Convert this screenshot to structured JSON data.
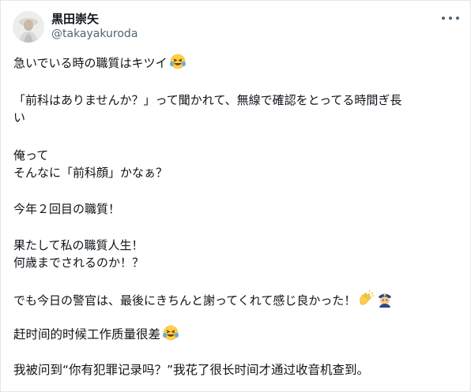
{
  "author": {
    "name": "黒田崇矢",
    "handle": "@takayakuroda"
  },
  "tweet": {
    "line1": "急いでいる時の職質はキツイ",
    "line2": "「前科はありませんか？」って聞かれて、無線で確認をとってる時間ぎ長",
    "line3": "い",
    "line4": "俺って",
    "line5": "そんなに「前科顔」かなぁ？",
    "line6": "今年２回目の職質！",
    "line7": "果たして私の職質人生！",
    "line8": "何歳までされるのか！？",
    "line9": "でも今日の警官は、最後にきちんと謝ってくれて感じ良かった！",
    "emojis": [
      "crying-laughing-face",
      "clapping-hands",
      "police-officer"
    ]
  },
  "translation": {
    "line1": "赶时间的时候工作质量很差",
    "line2": "我被问到“你有犯罪记录吗？”我花了很长时间才通过收音机查到。"
  },
  "colors": {
    "text": "#0f1419",
    "secondary": "#536471",
    "emoji_yellow": "#ffcc4d",
    "tears": "#5dadec",
    "police_blue": "#2a4a8a"
  }
}
